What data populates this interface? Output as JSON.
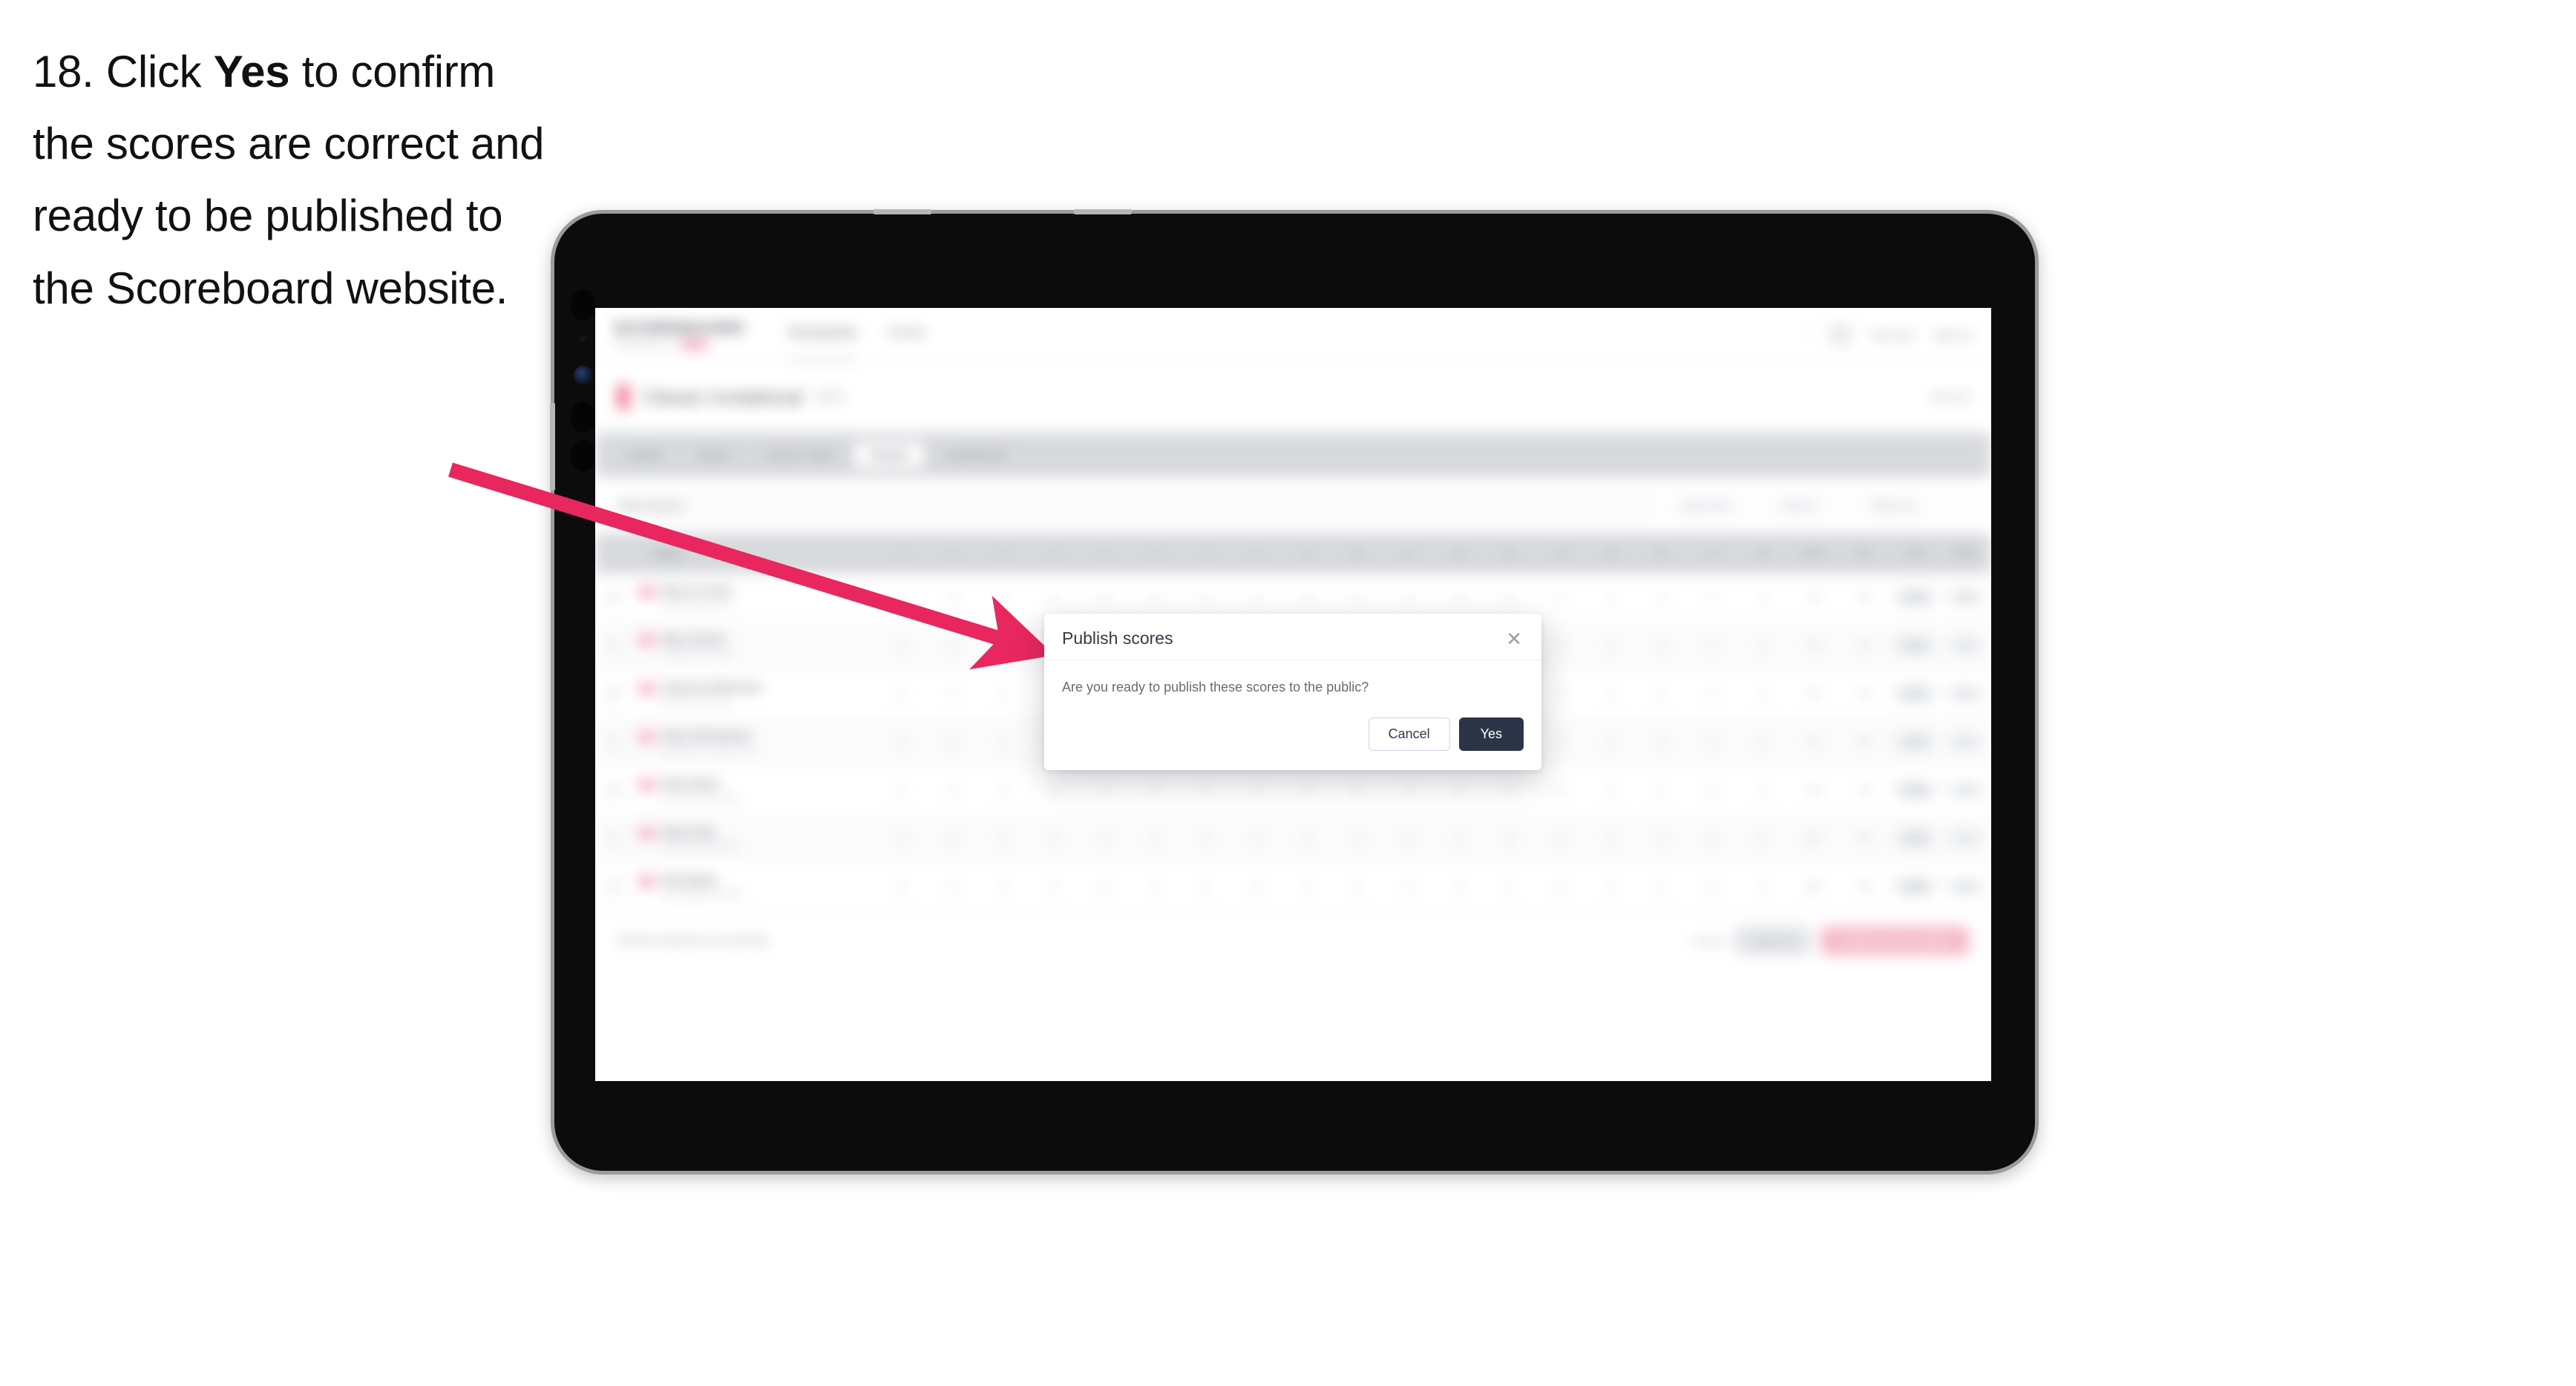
{
  "caption": {
    "number": "18.",
    "pre": "Click",
    "emphasis": "Yes",
    "post": "to confirm the scores are correct and ready to be published to the Scoreboard website."
  },
  "colors": {
    "arrow": "#E8275F",
    "yes_button": "#2C3547",
    "cancel_border": "#C9D8EE",
    "brand_pink": "#F2708F",
    "device_bezel": "#9B9B9B",
    "device_body": "#0C0C0C"
  },
  "device": {
    "type": "tablet",
    "orientation": "landscape"
  },
  "app": {
    "nav": {
      "brand_word": "SCOREBOARD",
      "brand_sub_text": "POWERED BY",
      "brand_pill": "BETA",
      "links": [
        {
          "label": "Tournaments",
          "active": true
        },
        {
          "label": "Events",
          "active": false
        }
      ],
      "right": {
        "user_label": "Test User",
        "signout_label": "Sign out"
      }
    },
    "page": {
      "title": "Classic Invitational",
      "badge": "2024",
      "right_label": "View all"
    },
    "tabs": [
      {
        "label": "Details",
        "active": false
      },
      {
        "label": "Draws",
        "active": false
      },
      {
        "label": "Courts / Order",
        "active": false
      },
      {
        "label": "Results",
        "active": true
      },
      {
        "label": "Leaderboard",
        "active": false
      }
    ],
    "filters": {
      "search_placeholder": "Search players",
      "controls": [
        "Play format",
        "Round 1",
        "Table only"
      ]
    },
    "table": {
      "columns": [
        "Player",
        "1",
        "2",
        "3",
        "4",
        "5",
        "6",
        "7",
        "8",
        "9",
        "10",
        "11",
        "12",
        "13",
        "14",
        "15",
        "16",
        "17",
        "18",
        "Gross",
        "Net",
        "Total",
        "Points"
      ],
      "rows": [
        {
          "name": "Marcus Turner",
          "club": "Riverside Golf Club",
          "scores": [
            "4",
            "5",
            "3",
            "4",
            "5",
            "4",
            "3",
            "4",
            "5",
            "4",
            "4",
            "3",
            "5",
            "4",
            "4",
            "3",
            "4",
            "5"
          ],
          "gross": "72",
          "net": "70",
          "total": "142",
          "points": "100"
        },
        {
          "name": "Rhys Parnell",
          "club": "Lakeview Golf Club",
          "scores": [
            "5",
            "4",
            "4",
            "3",
            "5",
            "4",
            "4",
            "5",
            "4",
            "3",
            "4",
            "4",
            "5",
            "3",
            "4",
            "4",
            "5",
            "4"
          ],
          "gross": "74",
          "net": "71",
          "total": "145",
          "points": "94"
        },
        {
          "name": "Cameron Robertson",
          "club": "Highland Park Golf",
          "scores": [
            "4",
            "4",
            "5",
            "4",
            "4",
            "5",
            "3",
            "4",
            "4",
            "5",
            "4",
            "3",
            "4",
            "5",
            "4",
            "4",
            "4",
            "4"
          ],
          "gross": "75",
          "net": "72",
          "total": "147",
          "points": "88"
        },
        {
          "name": "Oliver Richardson",
          "club": "Westbourne Country Club",
          "scores": [
            "5",
            "5",
            "4",
            "4",
            "5",
            "4",
            "4",
            "4",
            "5",
            "4",
            "5",
            "4",
            "4",
            "4",
            "5",
            "3",
            "4",
            "5"
          ],
          "gross": "77",
          "net": "73",
          "total": "150",
          "points": "82"
        },
        {
          "name": "Ethan Ward",
          "club": "Greenfields Golf Club",
          "scores": [
            "4",
            "5",
            "5",
            "4",
            "5",
            "5",
            "4",
            "4",
            "4",
            "5",
            "4",
            "5",
            "4",
            "4",
            "5",
            "4",
            "5",
            "4"
          ],
          "gross": "79",
          "net": "74",
          "total": "153",
          "points": "76"
        },
        {
          "name": "Ryan Kelly",
          "club": "Northbrook Golf Club",
          "scores": [
            "5",
            "5",
            "4",
            "5",
            "4",
            "5",
            "5",
            "4",
            "5",
            "4",
            "5",
            "4",
            "5",
            "4",
            "4",
            "5",
            "4",
            "5"
          ],
          "gross": "81",
          "net": "75",
          "total": "156",
          "points": "70"
        },
        {
          "name": "Nick Bailey",
          "club": "Stonebridge Golf Club",
          "scores": [
            "5",
            "4",
            "5",
            "5",
            "5",
            "4",
            "5",
            "5",
            "4",
            "5",
            "4",
            "5",
            "4",
            "5",
            "5",
            "4",
            "5",
            "4"
          ],
          "gross": "83",
          "net": "76",
          "total": "159",
          "points": "64"
        }
      ]
    },
    "action_bar": {
      "note": "Results published successfully",
      "cancel_label": "Cancel",
      "save_label": "Save all",
      "publish_label": "Publish scores to public"
    }
  },
  "modal": {
    "title": "Publish scores",
    "close_icon": "✕",
    "body": "Are you ready to publish these scores to the public?",
    "cancel_label": "Cancel",
    "confirm_label": "Yes"
  }
}
